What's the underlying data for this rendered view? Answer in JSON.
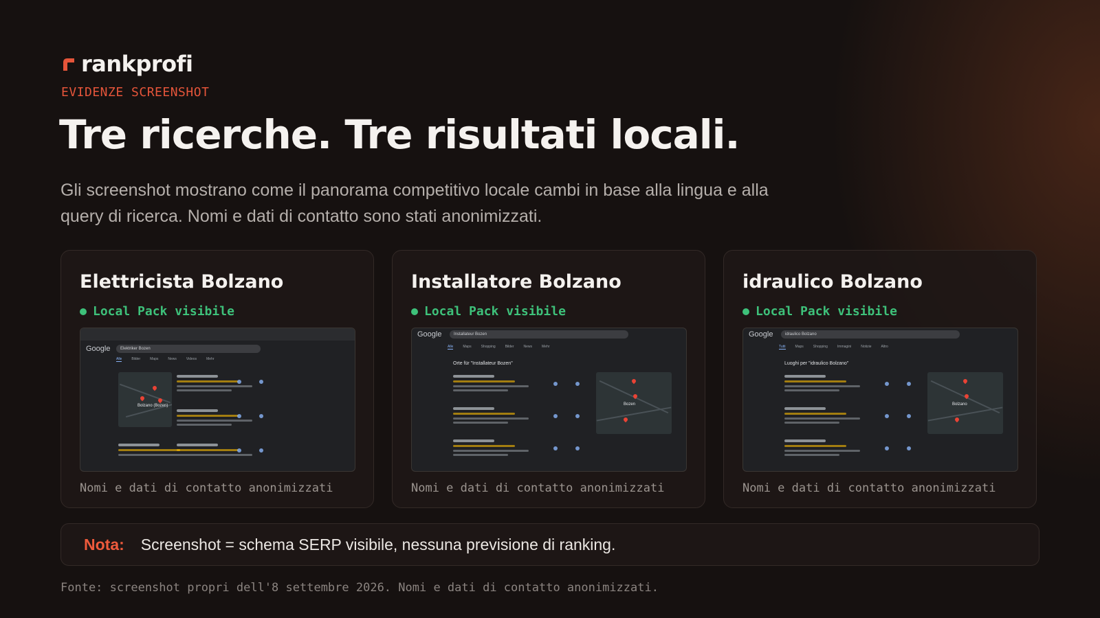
{
  "brand": {
    "name": "rankprofi",
    "logo_icon": "rankprofi-logo-icon",
    "accent": "#e5553a"
  },
  "eyebrow": "EVIDENZE SCREENSHOT",
  "title": "Tre ricerche. Tre risultati locali.",
  "subtitle": "Gli screenshot mostrano come il panorama competitivo locale cambi in base alla lingua e alla query di ricerca. Nomi e dati di contatto sono stati anonimizzati.",
  "cards": [
    {
      "title": "Elettricista Bolzano",
      "badge": "Local Pack visibile",
      "caption": "Nomi e dati di contatto anonimizzati",
      "serp": {
        "query": "Elektriker Bozen",
        "heading": "",
        "city": "Bolzano (Bozen)",
        "tabs": [
          "Alle",
          "Bilder",
          "Maps",
          "News",
          "Videos",
          "Mehr"
        ]
      }
    },
    {
      "title": "Installatore Bolzano",
      "badge": "Local Pack visibile",
      "caption": "Nomi e dati di contatto anonimizzati",
      "serp": {
        "query": "Installateur Bozen",
        "heading": "Orte für \"Installateur Bozen\"",
        "city": "Bozen",
        "tabs": [
          "Alle",
          "Maps",
          "Shopping",
          "Bilder",
          "News",
          "Mehr"
        ]
      }
    },
    {
      "title": "idraulico Bolzano",
      "badge": "Local Pack visibile",
      "caption": "Nomi e dati di contatto anonimizzati",
      "serp": {
        "query": "idraulico Bolzano",
        "heading": "Luoghi per \"idraulico Bolzano\"",
        "city": "Bolzano",
        "tabs": [
          "Tutti",
          "Maps",
          "Shopping",
          "Immagini",
          "Notizie",
          "Altro"
        ]
      }
    }
  ],
  "note": {
    "label": "Nota:",
    "text": "Screenshot = schema SERP visibile, nessuna previsione di ranking."
  },
  "source": "Fonte: screenshot propri dell'8 settembre 2026. Nomi e dati di contatto anonimizzati.",
  "colors": {
    "background": "#161110",
    "badge_green": "#3ec17a",
    "note_label": "#ee5a3c"
  }
}
